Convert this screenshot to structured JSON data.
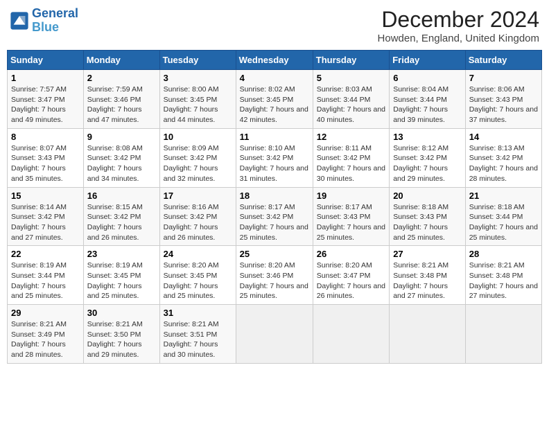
{
  "logo": {
    "line1": "General",
    "line2": "Blue"
  },
  "title": "December 2024",
  "subtitle": "Howden, England, United Kingdom",
  "headers": [
    "Sunday",
    "Monday",
    "Tuesday",
    "Wednesday",
    "Thursday",
    "Friday",
    "Saturday"
  ],
  "weeks": [
    [
      {
        "day": "1",
        "sunrise": "Sunrise: 7:57 AM",
        "sunset": "Sunset: 3:47 PM",
        "daylight": "Daylight: 7 hours and 49 minutes."
      },
      {
        "day": "2",
        "sunrise": "Sunrise: 7:59 AM",
        "sunset": "Sunset: 3:46 PM",
        "daylight": "Daylight: 7 hours and 47 minutes."
      },
      {
        "day": "3",
        "sunrise": "Sunrise: 8:00 AM",
        "sunset": "Sunset: 3:45 PM",
        "daylight": "Daylight: 7 hours and 44 minutes."
      },
      {
        "day": "4",
        "sunrise": "Sunrise: 8:02 AM",
        "sunset": "Sunset: 3:45 PM",
        "daylight": "Daylight: 7 hours and 42 minutes."
      },
      {
        "day": "5",
        "sunrise": "Sunrise: 8:03 AM",
        "sunset": "Sunset: 3:44 PM",
        "daylight": "Daylight: 7 hours and 40 minutes."
      },
      {
        "day": "6",
        "sunrise": "Sunrise: 8:04 AM",
        "sunset": "Sunset: 3:44 PM",
        "daylight": "Daylight: 7 hours and 39 minutes."
      },
      {
        "day": "7",
        "sunrise": "Sunrise: 8:06 AM",
        "sunset": "Sunset: 3:43 PM",
        "daylight": "Daylight: 7 hours and 37 minutes."
      }
    ],
    [
      {
        "day": "8",
        "sunrise": "Sunrise: 8:07 AM",
        "sunset": "Sunset: 3:43 PM",
        "daylight": "Daylight: 7 hours and 35 minutes."
      },
      {
        "day": "9",
        "sunrise": "Sunrise: 8:08 AM",
        "sunset": "Sunset: 3:42 PM",
        "daylight": "Daylight: 7 hours and 34 minutes."
      },
      {
        "day": "10",
        "sunrise": "Sunrise: 8:09 AM",
        "sunset": "Sunset: 3:42 PM",
        "daylight": "Daylight: 7 hours and 32 minutes."
      },
      {
        "day": "11",
        "sunrise": "Sunrise: 8:10 AM",
        "sunset": "Sunset: 3:42 PM",
        "daylight": "Daylight: 7 hours and 31 minutes."
      },
      {
        "day": "12",
        "sunrise": "Sunrise: 8:11 AM",
        "sunset": "Sunset: 3:42 PM",
        "daylight": "Daylight: 7 hours and 30 minutes."
      },
      {
        "day": "13",
        "sunrise": "Sunrise: 8:12 AM",
        "sunset": "Sunset: 3:42 PM",
        "daylight": "Daylight: 7 hours and 29 minutes."
      },
      {
        "day": "14",
        "sunrise": "Sunrise: 8:13 AM",
        "sunset": "Sunset: 3:42 PM",
        "daylight": "Daylight: 7 hours and 28 minutes."
      }
    ],
    [
      {
        "day": "15",
        "sunrise": "Sunrise: 8:14 AM",
        "sunset": "Sunset: 3:42 PM",
        "daylight": "Daylight: 7 hours and 27 minutes."
      },
      {
        "day": "16",
        "sunrise": "Sunrise: 8:15 AM",
        "sunset": "Sunset: 3:42 PM",
        "daylight": "Daylight: 7 hours and 26 minutes."
      },
      {
        "day": "17",
        "sunrise": "Sunrise: 8:16 AM",
        "sunset": "Sunset: 3:42 PM",
        "daylight": "Daylight: 7 hours and 26 minutes."
      },
      {
        "day": "18",
        "sunrise": "Sunrise: 8:17 AM",
        "sunset": "Sunset: 3:42 PM",
        "daylight": "Daylight: 7 hours and 25 minutes."
      },
      {
        "day": "19",
        "sunrise": "Sunrise: 8:17 AM",
        "sunset": "Sunset: 3:43 PM",
        "daylight": "Daylight: 7 hours and 25 minutes."
      },
      {
        "day": "20",
        "sunrise": "Sunrise: 8:18 AM",
        "sunset": "Sunset: 3:43 PM",
        "daylight": "Daylight: 7 hours and 25 minutes."
      },
      {
        "day": "21",
        "sunrise": "Sunrise: 8:18 AM",
        "sunset": "Sunset: 3:44 PM",
        "daylight": "Daylight: 7 hours and 25 minutes."
      }
    ],
    [
      {
        "day": "22",
        "sunrise": "Sunrise: 8:19 AM",
        "sunset": "Sunset: 3:44 PM",
        "daylight": "Daylight: 7 hours and 25 minutes."
      },
      {
        "day": "23",
        "sunrise": "Sunrise: 8:19 AM",
        "sunset": "Sunset: 3:45 PM",
        "daylight": "Daylight: 7 hours and 25 minutes."
      },
      {
        "day": "24",
        "sunrise": "Sunrise: 8:20 AM",
        "sunset": "Sunset: 3:45 PM",
        "daylight": "Daylight: 7 hours and 25 minutes."
      },
      {
        "day": "25",
        "sunrise": "Sunrise: 8:20 AM",
        "sunset": "Sunset: 3:46 PM",
        "daylight": "Daylight: 7 hours and 25 minutes."
      },
      {
        "day": "26",
        "sunrise": "Sunrise: 8:20 AM",
        "sunset": "Sunset: 3:47 PM",
        "daylight": "Daylight: 7 hours and 26 minutes."
      },
      {
        "day": "27",
        "sunrise": "Sunrise: 8:21 AM",
        "sunset": "Sunset: 3:48 PM",
        "daylight": "Daylight: 7 hours and 27 minutes."
      },
      {
        "day": "28",
        "sunrise": "Sunrise: 8:21 AM",
        "sunset": "Sunset: 3:48 PM",
        "daylight": "Daylight: 7 hours and 27 minutes."
      }
    ],
    [
      {
        "day": "29",
        "sunrise": "Sunrise: 8:21 AM",
        "sunset": "Sunset: 3:49 PM",
        "daylight": "Daylight: 7 hours and 28 minutes."
      },
      {
        "day": "30",
        "sunrise": "Sunrise: 8:21 AM",
        "sunset": "Sunset: 3:50 PM",
        "daylight": "Daylight: 7 hours and 29 minutes."
      },
      {
        "day": "31",
        "sunrise": "Sunrise: 8:21 AM",
        "sunset": "Sunset: 3:51 PM",
        "daylight": "Daylight: 7 hours and 30 minutes."
      },
      null,
      null,
      null,
      null
    ]
  ]
}
